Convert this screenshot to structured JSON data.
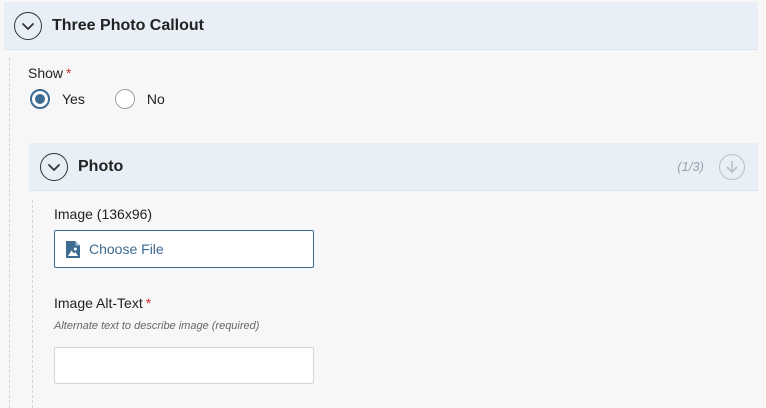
{
  "section": {
    "title": "Three Photo Callout",
    "toggle_icon": "chevron-down-icon"
  },
  "show_field": {
    "label": "Show",
    "required_mark": "*",
    "options": [
      {
        "label": "Yes",
        "checked": true
      },
      {
        "label": "No",
        "checked": false
      }
    ]
  },
  "photo_panel": {
    "title": "Photo",
    "counter": "(1/3)",
    "move_icon": "arrow-down-icon"
  },
  "image_field": {
    "label": "Image (136x96)",
    "button_label": "Choose File",
    "icon": "image-file-icon"
  },
  "alt_text_field": {
    "label": "Image Alt-Text",
    "required_mark": "*",
    "help": "Alternate text to describe image (required)",
    "value": ""
  },
  "colors": {
    "accent": "#3d6b92",
    "header_bg": "#e9eff6",
    "required": "#d0302f",
    "page_bg": "#f7f7f7"
  }
}
